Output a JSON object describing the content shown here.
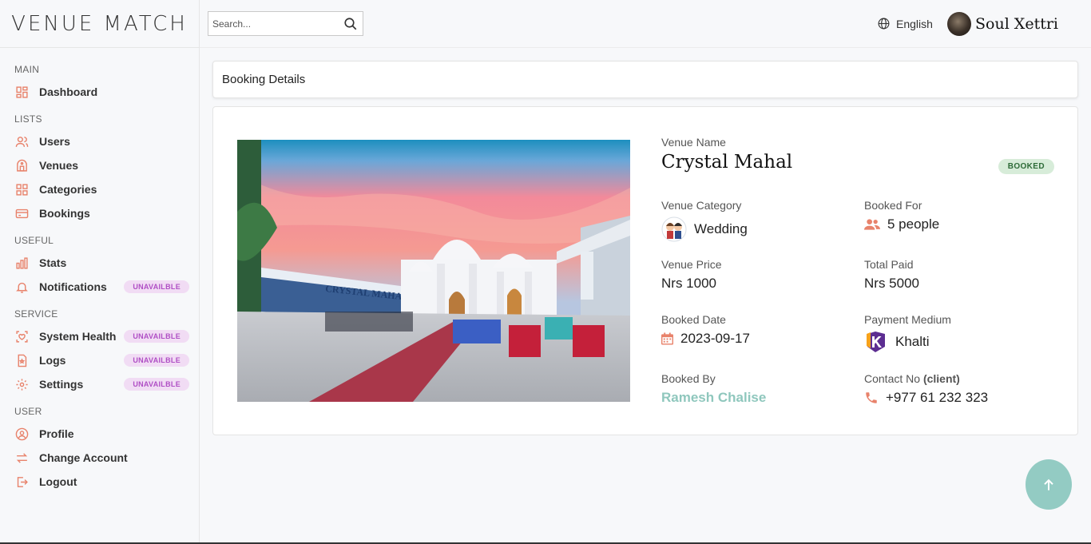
{
  "app": {
    "logo": "VENUE MATCH"
  },
  "topbar": {
    "search_placeholder": "Search...",
    "language": "English",
    "user_name": "Soul Xettri"
  },
  "sidebar": {
    "sections": [
      {
        "title": "MAIN",
        "items": [
          {
            "label": "Dashboard",
            "icon": "dashboard-icon"
          }
        ]
      },
      {
        "title": "LISTS",
        "items": [
          {
            "label": "Users",
            "icon": "users-icon"
          },
          {
            "label": "Venues",
            "icon": "venue-icon"
          },
          {
            "label": "Categories",
            "icon": "categories-icon"
          },
          {
            "label": "Bookings",
            "icon": "bookings-icon"
          }
        ]
      },
      {
        "title": "USEFUL",
        "items": [
          {
            "label": "Stats",
            "icon": "stats-icon"
          },
          {
            "label": "Notifications",
            "icon": "bell-icon",
            "badge": "UNAVAILBLE"
          }
        ]
      },
      {
        "title": "SERVICE",
        "items": [
          {
            "label": "System Health",
            "icon": "health-icon",
            "badge": "UNAVAILBLE"
          },
          {
            "label": "Logs",
            "icon": "logs-icon",
            "badge": "UNAVAILBLE"
          },
          {
            "label": "Settings",
            "icon": "gear-icon",
            "badge": "UNAVAILBLE"
          }
        ]
      },
      {
        "title": "USER",
        "items": [
          {
            "label": "Profile",
            "icon": "profile-icon"
          },
          {
            "label": "Change Account",
            "icon": "swap-icon"
          },
          {
            "label": "Logout",
            "icon": "logout-icon"
          }
        ]
      }
    ]
  },
  "page": {
    "header_title": "Booking Details"
  },
  "booking": {
    "venue_name_label": "Venue Name",
    "venue_name": "Crystal Mahal",
    "status": "BOOKED",
    "category_label": "Venue Category",
    "category": "Wedding",
    "booked_for_label": "Booked For",
    "booked_for": "5 people",
    "price_label": "Venue Price",
    "price": "Nrs 1000",
    "total_paid_label": "Total Paid",
    "total_paid": "Nrs 5000",
    "booked_date_label": "Booked Date",
    "booked_date": "2023-09-17",
    "payment_label": "Payment Medium",
    "payment": "Khalti",
    "booked_by_label": "Booked By",
    "booked_by": "Ramesh Chalise",
    "contact_label": "Contact No",
    "contact_suffix": "(client)",
    "contact": "+977 61 232 323",
    "image_sign": "CRYSTAL MAHAL"
  },
  "colors": {
    "accent": "#e8826b",
    "teal": "#8fc7bd",
    "booked_bg": "#d7ecd9",
    "unavail_bg": "#f1dcf4"
  }
}
